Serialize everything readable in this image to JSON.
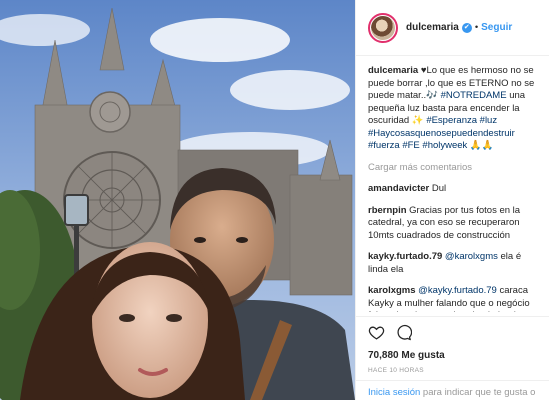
{
  "post": {
    "username": "dulcemaria",
    "follow_label": "Seguir",
    "separator": "•",
    "verified_glyph": "✔"
  },
  "caption": {
    "username": "dulcemaria",
    "parts": [
      "♥Lo que es hermoso no se puede borrar ,lo que es ETERNO no se puede matar..🎶 ",
      "#NOTREDAME",
      " una pequeña luz basta para encender la oscuridad ✨ ",
      "#Esperanza",
      " ",
      "#luz",
      " ",
      "#Haycosasquenosepuedendestruir",
      " ",
      "#fuerza",
      " ",
      "#FE",
      " ",
      "#holyweek",
      " 🙏🙏"
    ]
  },
  "load_more_label": "Cargar más comentarios",
  "comments": [
    {
      "user": "amandavicter",
      "text": "Dul"
    },
    {
      "user": "rbernpin",
      "text": "Gracias por tus fotos en la catedral, ya con eso se recuperaron 10mts cuadrados de construcción"
    },
    {
      "user": "kayky.furtado.79",
      "mention": "@karolxgms",
      "text": " ela é linda ela"
    },
    {
      "user": "karolxgms",
      "mention": "@kayky.furtado.79",
      "text": " caraca Kayky a mulher falando que o negócio foi queimado e tu achando ela bonita KK. Tem vergonha mam"
    }
  ],
  "actions": {
    "likes": "70,880 Me gusta",
    "time": "HACE 10 HORAS",
    "icons": [
      "heart-icon",
      "comment-icon"
    ]
  },
  "footer": {
    "login_link": "Inicia sesión",
    "login_text": " para indicar que te gusta o"
  },
  "colors": {
    "accent": "#3897f0",
    "hashtag": "#003569",
    "muted": "#999999",
    "border": "#efefef"
  }
}
